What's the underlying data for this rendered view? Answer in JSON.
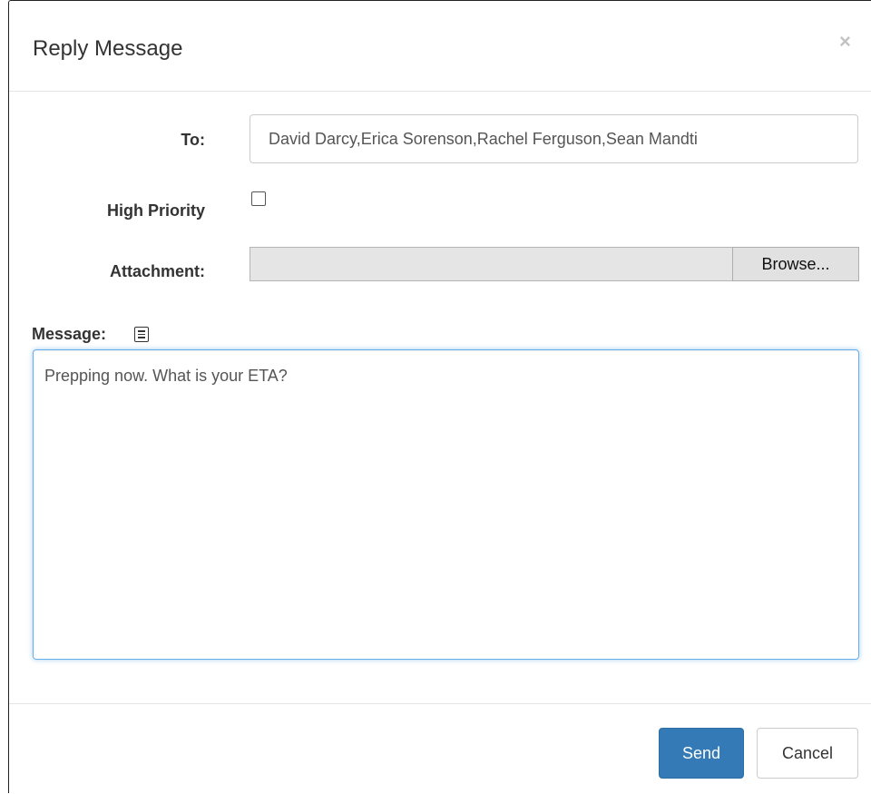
{
  "dialog": {
    "title": "Reply Message",
    "close_glyph": "×"
  },
  "form": {
    "to_label": "To:",
    "to_value": "David Darcy,Erica Sorenson,Rachel Ferguson,Sean Mandti",
    "priority_label": "High Priority",
    "priority_checked": false,
    "attachment_label": "Attachment:",
    "browse_label": "Browse...",
    "message_label": "Message:",
    "message_icon": "notes-icon",
    "message_value": "Prepping now. What is your ETA?"
  },
  "footer": {
    "send_label": "Send",
    "cancel_label": "Cancel"
  },
  "colors": {
    "primary": "#337ab7",
    "focus": "#66afe9"
  }
}
